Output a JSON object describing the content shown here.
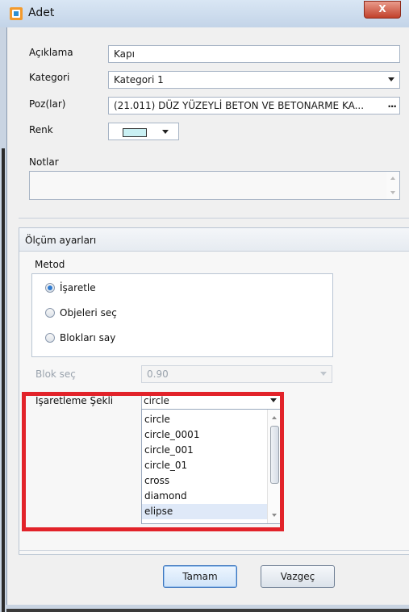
{
  "window": {
    "title": "Adet",
    "close_label": "X"
  },
  "fields": {
    "aciklama_label": "Açıklama",
    "aciklama_value": "Kapı",
    "kategori_label": "Kategori",
    "kategori_value": "Kategori 1",
    "poz_label": "Poz(lar)",
    "poz_value": "(21.011) DÜZ YÜZEYLİ BETON VE BETONARME KA...",
    "poz_dots": "...",
    "renk_label": "Renk",
    "renk_color": "#c9f0f3",
    "notlar_label": "Notlar",
    "notlar_value": ""
  },
  "olcum": {
    "title": "Ölçüm ayarları",
    "metod_title": "Metod",
    "options": [
      {
        "label": "İşaretle",
        "selected": true
      },
      {
        "label": "Objeleri seç",
        "selected": false
      },
      {
        "label": "Blokları say",
        "selected": false
      }
    ],
    "blok_sec_label": "Blok seç",
    "blok_sec_value": "0.90",
    "isaretleme_label": "İşaretleme Şekli",
    "isaretleme_value": "circle",
    "dropdown_items": [
      "circle",
      "circle_0001",
      "circle_001",
      "circle_01",
      "cross",
      "diamond",
      "elipse"
    ],
    "dropdown_selected_index": 6
  },
  "buttons": {
    "ok": "Tamam",
    "cancel": "Vazgeç"
  },
  "colors": {
    "highlight": "#e2232a",
    "selection": "#dfe9f8"
  }
}
